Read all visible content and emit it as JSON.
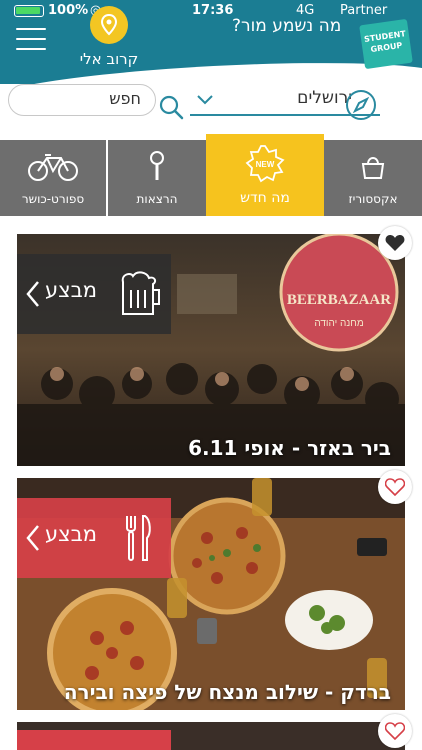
{
  "status_bar": {
    "battery": "100%",
    "time": "17:36",
    "network": "4G",
    "carrier": "Partner"
  },
  "header": {
    "near_label": "קרוב אלי",
    "title": "מה נשמע מור?",
    "logo_line1": "STUDENT",
    "logo_line2": "GROUP"
  },
  "search": {
    "placeholder": "חפש",
    "city": "ירושלים"
  },
  "categories": [
    {
      "label": "אקססוריז",
      "icon": "bag-icon"
    },
    {
      "label": "מה חדש",
      "icon": "new-badge-icon",
      "badge": "NEW",
      "active": true
    },
    {
      "label": "הרצאות",
      "icon": "microphone-icon"
    },
    {
      "label": "ספורט-כושר",
      "icon": "bicycle-icon"
    }
  ],
  "cards": [
    {
      "badge": "מבצע",
      "title": "ביר באזר - אופי 6.11",
      "sign_text": "BEERBAZAAR",
      "sign_sub": "מחנה יהודה",
      "heart_filled": true,
      "badge_color": "#2d2d2d"
    },
    {
      "badge": "מבצע",
      "title": "ברדק - שילוב מנצח של פיצה ובירה",
      "heart_filled": false,
      "badge_color": "#d64048"
    },
    {
      "heart_filled": false
    }
  ],
  "colors": {
    "header": "#1b7d93",
    "accent_yellow": "#f6c31e",
    "category_gray": "#6e6e6e",
    "promo_red": "#d64048"
  }
}
